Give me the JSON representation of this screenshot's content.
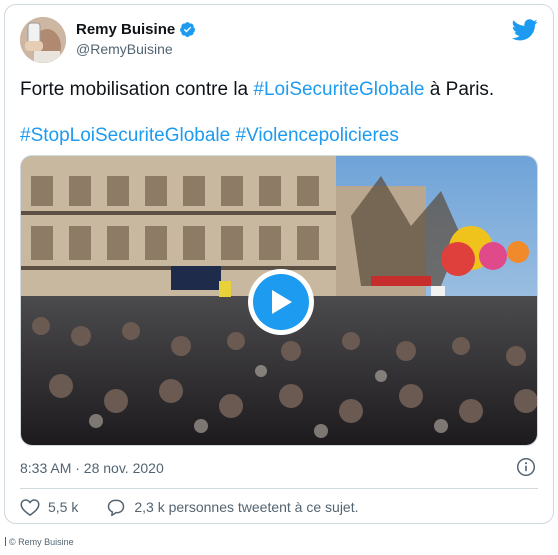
{
  "author": {
    "name": "Remy Buisine",
    "handle": "@RemyBuisine"
  },
  "tweet": {
    "line1_prefix": "Forte mobilisation contre la ",
    "line1_hashtag": "#LoiSecuriteGlobale",
    "line1_suffix": " à Paris.",
    "hashtag2": "#StopLoiSecuriteGlobale",
    "hashtag3": "#Violencepolicieres"
  },
  "meta": {
    "timestamp": "8:33 AM · 28 nov. 2020"
  },
  "actions": {
    "likes": "5,5 k",
    "retweets_text": "2,3 k personnes tweetent à ce sujet."
  },
  "credit": "© Remy Buisine",
  "colors": {
    "accent": "#1d9bf0",
    "text": "#0f1419",
    "muted": "#536471",
    "border": "#cfd9de"
  },
  "icons": {
    "logo": "twitter-bird-icon",
    "verified": "verified-badge-icon",
    "play": "play-icon",
    "info": "info-icon",
    "like": "heart-icon",
    "reply": "speech-bubble-icon"
  }
}
